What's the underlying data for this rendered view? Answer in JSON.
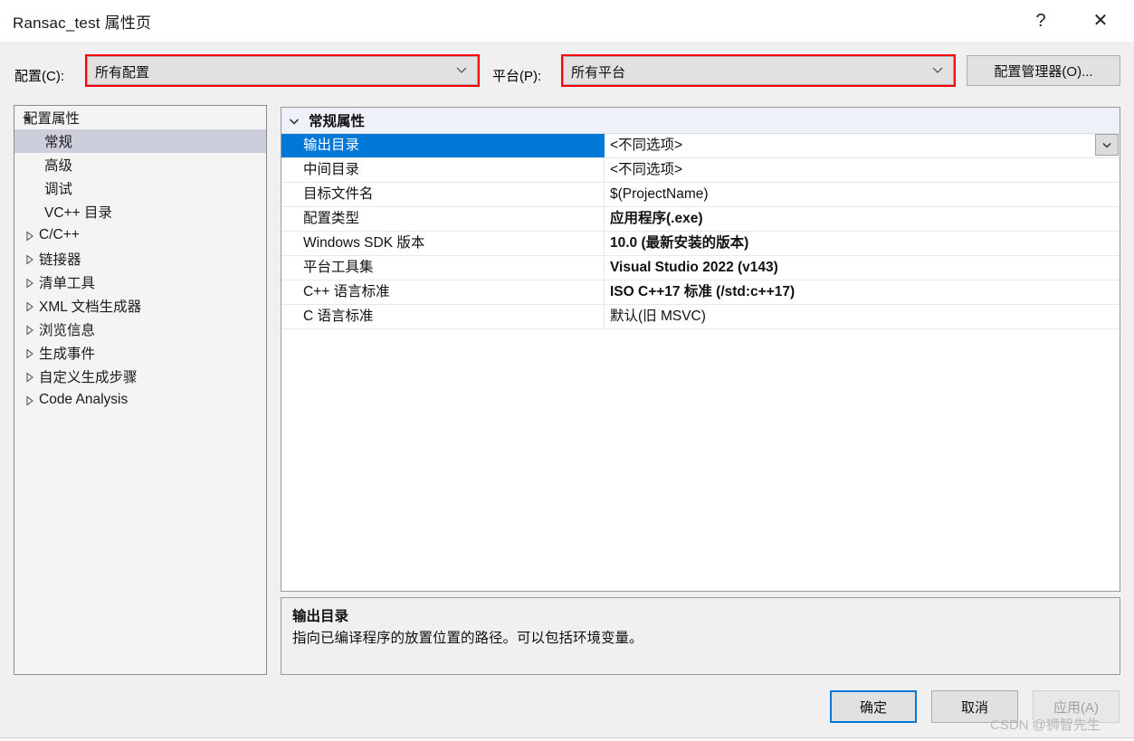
{
  "window": {
    "title": "Ransac_test 属性页",
    "help_glyph": "?",
    "close_glyph": "✕"
  },
  "toolbar": {
    "configuration_label": "配置(C):",
    "configuration_value": "所有配置",
    "platform_label": "平台(P):",
    "platform_value": "所有平台",
    "config_manager_label": "配置管理器(O)...",
    "highlight_color": "#ff0000"
  },
  "tree": {
    "items": [
      {
        "label": "配置属性",
        "level": 0,
        "expander": "down",
        "selected": false
      },
      {
        "label": "常规",
        "level": 1,
        "expander": "none",
        "selected": true
      },
      {
        "label": "高级",
        "level": 1,
        "expander": "none",
        "selected": false
      },
      {
        "label": "调试",
        "level": 1,
        "expander": "none",
        "selected": false
      },
      {
        "label": "VC++ 目录",
        "level": 1,
        "expander": "none",
        "selected": false
      },
      {
        "label": "C/C++",
        "level": 1,
        "expander": "right",
        "selected": false
      },
      {
        "label": "链接器",
        "level": 1,
        "expander": "right",
        "selected": false
      },
      {
        "label": "清单工具",
        "level": 1,
        "expander": "right",
        "selected": false
      },
      {
        "label": "XML 文档生成器",
        "level": 1,
        "expander": "right",
        "selected": false
      },
      {
        "label": "浏览信息",
        "level": 1,
        "expander": "right",
        "selected": false
      },
      {
        "label": "生成事件",
        "level": 1,
        "expander": "right",
        "selected": false
      },
      {
        "label": "自定义生成步骤",
        "level": 1,
        "expander": "right",
        "selected": false
      },
      {
        "label": "Code Analysis",
        "level": 1,
        "expander": "right",
        "selected": false
      }
    ]
  },
  "grid": {
    "section_title": "常规属性",
    "section_collapsed": false,
    "selection_color": "#0078d7",
    "rows": [
      {
        "name": "输出目录",
        "value": "<不同选项>",
        "bold": false,
        "selected": true
      },
      {
        "name": "中间目录",
        "value": "<不同选项>",
        "bold": false,
        "selected": false
      },
      {
        "name": "目标文件名",
        "value": "$(ProjectName)",
        "bold": false,
        "selected": false
      },
      {
        "name": "配置类型",
        "value": "应用程序(.exe)",
        "bold": true,
        "selected": false
      },
      {
        "name": "Windows SDK 版本",
        "value": "10.0 (最新安装的版本)",
        "bold": true,
        "selected": false
      },
      {
        "name": "平台工具集",
        "value": "Visual Studio 2022 (v143)",
        "bold": true,
        "selected": false
      },
      {
        "name": "C++ 语言标准",
        "value": "ISO C++17 标准 (/std:c++17)",
        "bold": true,
        "selected": false
      },
      {
        "name": "C 语言标准",
        "value": "默认(旧 MSVC)",
        "bold": false,
        "selected": false
      }
    ]
  },
  "description": {
    "title": "输出目录",
    "text": "指向已编译程序的放置位置的路径。可以包括环境变量。"
  },
  "buttons": {
    "ok_label": "确定",
    "cancel_label": "取消",
    "apply_label": "应用(A)"
  },
  "watermark": {
    "text": "CSDN @狮智先生"
  }
}
